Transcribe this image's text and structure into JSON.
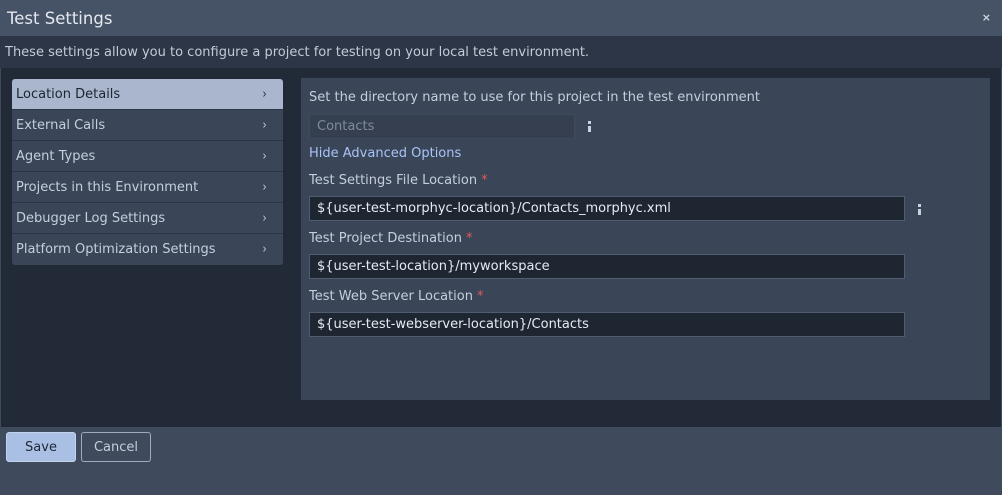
{
  "dialog": {
    "title": "Test Settings",
    "close_label": "×",
    "description": "These settings allow you to configure a project for testing on your local test environment."
  },
  "nav": {
    "items": [
      {
        "label": "Location Details",
        "active": true
      },
      {
        "label": "External Calls",
        "active": false
      },
      {
        "label": "Agent Types",
        "active": false
      },
      {
        "label": "Projects in this Environment",
        "active": false
      },
      {
        "label": "Debugger Log Settings",
        "active": false
      },
      {
        "label": "Platform Optimization Settings",
        "active": false
      }
    ],
    "chevron": "›"
  },
  "form": {
    "directory_label": "Set the directory name to use for this project in the test environment",
    "directory_value": "Contacts",
    "advanced_link": "Hide Advanced Options",
    "settings_file_label": "Test Settings File Location",
    "settings_file_value": "${user-test-morphyc-location}/Contacts_morphyc.xml",
    "project_dest_label": "Test Project Destination",
    "project_dest_value": "${user-test-location}/myworkspace",
    "web_server_label": "Test Web Server Location",
    "web_server_value": "${user-test-webserver-location}/Contacts",
    "required_marker": "*"
  },
  "footer": {
    "save_label": "Save",
    "cancel_label": "Cancel"
  },
  "colors": {
    "accent": "#a9bfe4",
    "active_nav": "#a9b6cd",
    "required": "#e05a5a",
    "link": "#a9c4f5"
  }
}
